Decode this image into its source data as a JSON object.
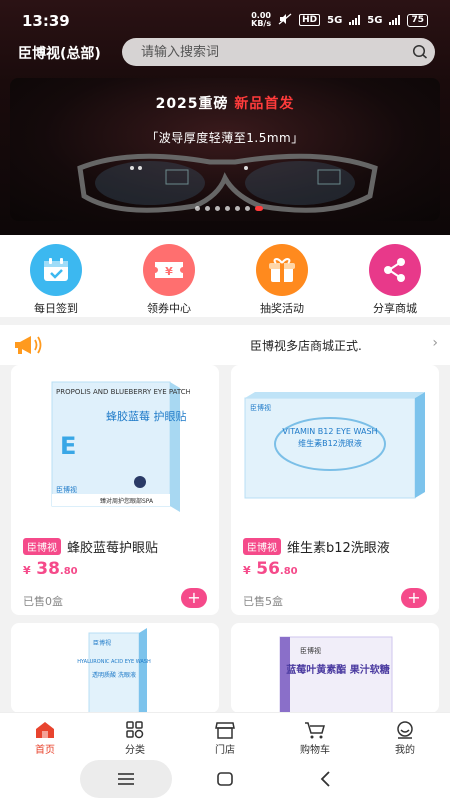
{
  "status_bar": {
    "time": "13:39",
    "net_speed_value": "0.00",
    "net_speed_unit": "KB/s",
    "hd": "HD",
    "net1": "5G",
    "net2": "5G",
    "battery": "75"
  },
  "header": {
    "store_name": "臣博视(总部)",
    "search_placeholder": "请输入搜索词"
  },
  "banner": {
    "title_prefix": "2025重磅",
    "title_highlight": "新品首发",
    "subtitle": "「波导厚度轻薄至1.5mm」",
    "dot_count": 7,
    "active_dot": 6
  },
  "quick_entries": [
    {
      "label": "每日签到",
      "icon": "calendar-check-icon",
      "color": "#3cb8f0"
    },
    {
      "label": "领券中心",
      "icon": "coupon-icon",
      "color": "#ff6f6f"
    },
    {
      "label": "抽奖活动",
      "icon": "gift-icon",
      "color": "#ff8a1e"
    },
    {
      "label": "分享商城",
      "icon": "share-icon",
      "color": "#e8398a"
    }
  ],
  "notice": {
    "text": "臣博视多店商城正式."
  },
  "products": [
    {
      "tag": "臣博视",
      "name": "蜂胶蓝莓护眼贴",
      "currency": "¥",
      "price_int": "38",
      "price_dec": ".80",
      "sold": "已售0盒",
      "box_title_en": "PROPOLIS AND BLUEBERRY EYE PATCH",
      "box_title_cn": "蜂胶蓝莓 护眼贴",
      "box_brand": "臣博视",
      "box_note": "臻对周护您眼部SPA"
    },
    {
      "tag": "臣博视",
      "name": "维生素b12洗眼液",
      "currency": "¥",
      "price_int": "56",
      "price_dec": ".80",
      "sold": "已售5盒",
      "box_title_en": "VITAMIN B12 EYE WASH",
      "box_title_cn": "维生素B12洗眼液",
      "box_brand": "臣博视"
    },
    {
      "box_brand": "臣博视",
      "box_title_en": "HYALURONIC ACID EYE WASH",
      "box_title_cn": "透明质酸 洗眼液"
    },
    {
      "box_brand": "臣博视",
      "box_title_cn": "蓝莓叶黄素酯 果汁软糖"
    }
  ],
  "tabbar": [
    {
      "label": "首页",
      "icon": "home-icon",
      "active": true
    },
    {
      "label": "分类",
      "icon": "category-icon",
      "active": false
    },
    {
      "label": "门店",
      "icon": "store-icon",
      "active": false
    },
    {
      "label": "购物车",
      "icon": "cart-icon",
      "active": false
    },
    {
      "label": "我的",
      "icon": "profile-icon",
      "active": false
    }
  ],
  "colors": {
    "accent_pink": "#f54a8a",
    "tab_active": "#e8442e",
    "banner_red": "#ff3b3b"
  }
}
